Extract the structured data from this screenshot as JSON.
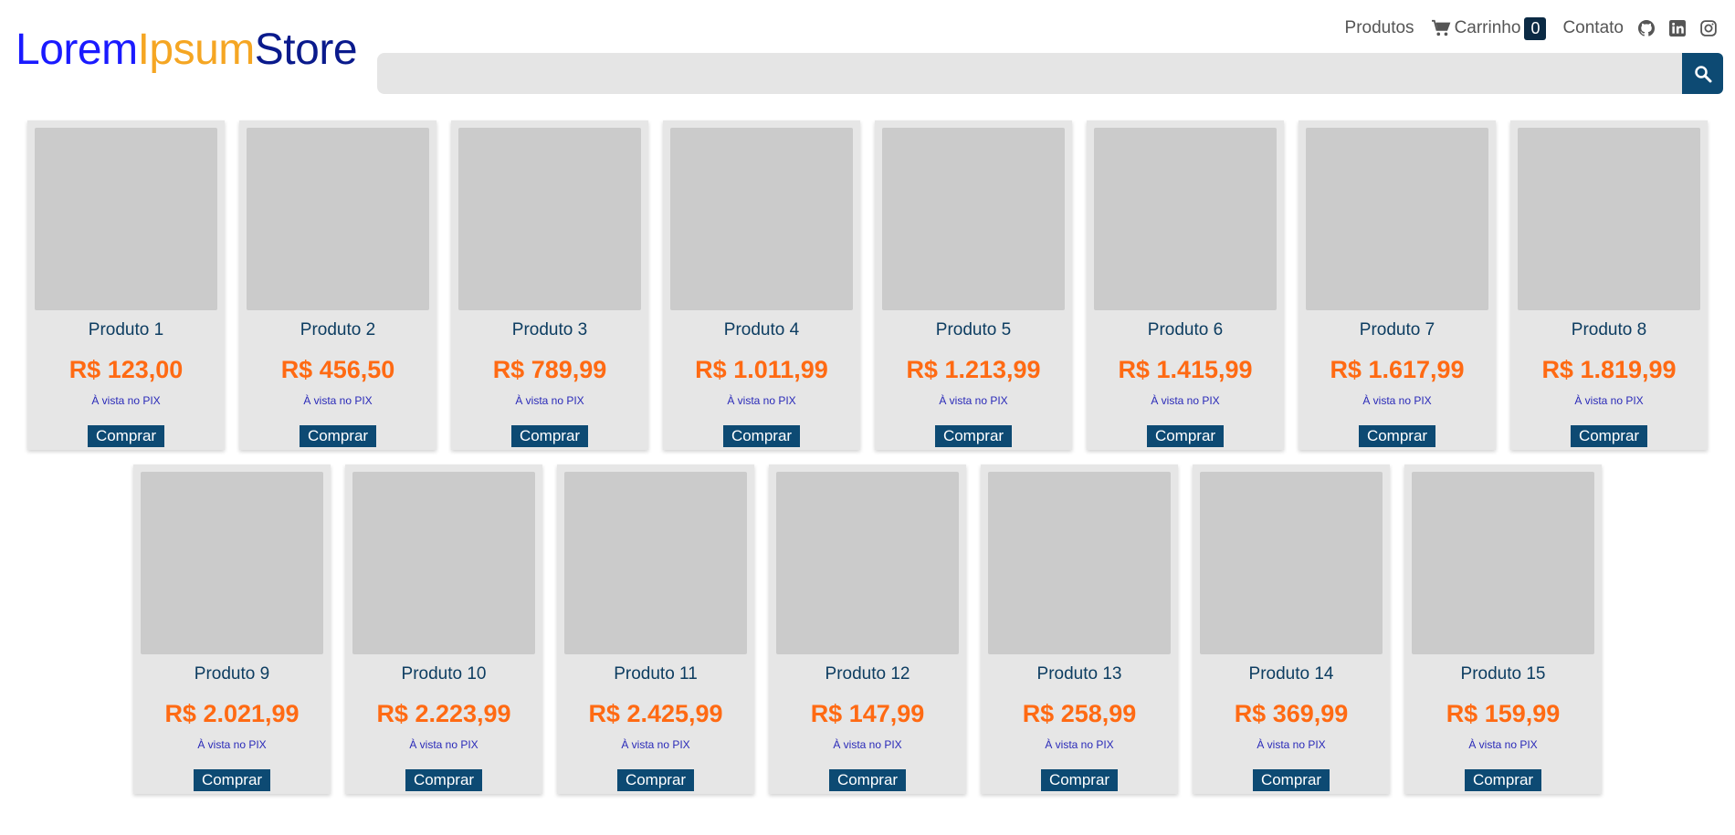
{
  "logo": {
    "part1": "Lorem",
    "part2": "Ipsum",
    "part3": "Store"
  },
  "nav": {
    "produtos": "Produtos",
    "carrinho": "Carrinho",
    "cart_count": "0",
    "contato": "Contato"
  },
  "search": {
    "placeholder": ""
  },
  "products": [
    {
      "name": "Produto 1",
      "price": "R$ 123,00",
      "note": "À vista no PIX",
      "button": "Comprar"
    },
    {
      "name": "Produto 2",
      "price": "R$ 456,50",
      "note": "À vista no PIX",
      "button": "Comprar"
    },
    {
      "name": "Produto 3",
      "price": "R$ 789,99",
      "note": "À vista no PIX",
      "button": "Comprar"
    },
    {
      "name": "Produto 4",
      "price": "R$ 1.011,99",
      "note": "À vista no PIX",
      "button": "Comprar"
    },
    {
      "name": "Produto 5",
      "price": "R$ 1.213,99",
      "note": "À vista no PIX",
      "button": "Comprar"
    },
    {
      "name": "Produto 6",
      "price": "R$ 1.415,99",
      "note": "À vista no PIX",
      "button": "Comprar"
    },
    {
      "name": "Produto 7",
      "price": "R$ 1.617,99",
      "note": "À vista no PIX",
      "button": "Comprar"
    },
    {
      "name": "Produto 8",
      "price": "R$ 1.819,99",
      "note": "À vista no PIX",
      "button": "Comprar"
    },
    {
      "name": "Produto 9",
      "price": "R$ 2.021,99",
      "note": "À vista no PIX",
      "button": "Comprar"
    },
    {
      "name": "Produto 10",
      "price": "R$ 2.223,99",
      "note": "À vista no PIX",
      "button": "Comprar"
    },
    {
      "name": "Produto 11",
      "price": "R$ 2.425,99",
      "note": "À vista no PIX",
      "button": "Comprar"
    },
    {
      "name": "Produto 12",
      "price": "R$ 147,99",
      "note": "À vista no PIX",
      "button": "Comprar"
    },
    {
      "name": "Produto 13",
      "price": "R$ 258,99",
      "note": "À vista no PIX",
      "button": "Comprar"
    },
    {
      "name": "Produto 14",
      "price": "R$ 369,99",
      "note": "À vista no PIX",
      "button": "Comprar"
    },
    {
      "name": "Produto 15",
      "price": "R$ 159,99",
      "note": "À vista no PIX",
      "button": "Comprar"
    }
  ],
  "colors": {
    "primary": "#0d4a73",
    "price": "#ff6a13",
    "card_bg": "#e6e6e6",
    "thumb": "#cbcbcb"
  },
  "icons": [
    "cart-icon",
    "github-icon",
    "linkedin-icon",
    "instagram-icon",
    "search-icon"
  ]
}
